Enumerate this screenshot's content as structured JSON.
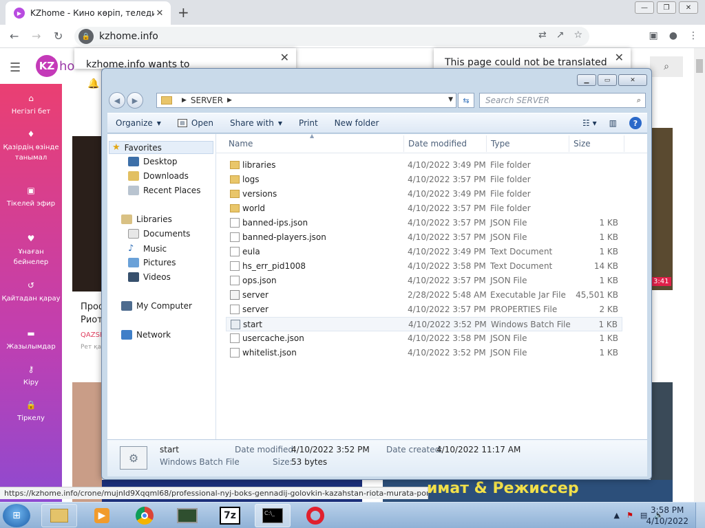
{
  "browser": {
    "tab_title": "KZhome - Кино көріп, теледидар",
    "url": "kzhome.info",
    "status_url": "https://kzhome.info/crone/mujnId9Xqqml68/professional-nyj-boks-gennadij-golovkin-kazahstan-riota-murata-poni"
  },
  "popups": {
    "permission_text": "kzhome.info wants to",
    "translate_text": "This page could not be translated"
  },
  "site": {
    "logo_letters": "KZ",
    "logo_text": "ho",
    "sidebar": [
      {
        "icon": "home-icon",
        "label": "Негізгі бет"
      },
      {
        "icon": "fire-icon",
        "label": "Қазірдің өзінде танымал"
      },
      {
        "icon": "live-icon",
        "label": "Тікелей эфир"
      },
      {
        "icon": "heart-icon",
        "label": "Ұнаған бейнелер"
      },
      {
        "icon": "history-icon",
        "label": "Қайтадан қарау"
      },
      {
        "icon": "folder-icon",
        "label": "Жазылымдар"
      },
      {
        "icon": "key-icon",
        "label": "Кіру"
      },
      {
        "icon": "lock-icon",
        "label": "Тіркелу"
      }
    ],
    "card": {
      "title_line1": "Проф",
      "title_line2": "Риота",
      "channel": "QAZSP",
      "meta": "Рет қа",
      "time_badge": "3:41"
    },
    "banner_text": "имат & Режиссер"
  },
  "explorer": {
    "breadcrumb": "SERVER",
    "search_placeholder": "Search SERVER",
    "commands": {
      "organize": "Organize",
      "open": "Open",
      "share": "Share with",
      "print": "Print",
      "new_folder": "New folder"
    },
    "nav": {
      "favorites": "Favorites",
      "desktop": "Desktop",
      "downloads": "Downloads",
      "recent": "Recent Places",
      "libraries": "Libraries",
      "documents": "Documents",
      "music": "Music",
      "pictures": "Pictures",
      "videos": "Videos",
      "computer": "My Computer",
      "network": "Network"
    },
    "columns": {
      "name": "Name",
      "date": "Date modified",
      "type": "Type",
      "size": "Size"
    },
    "files": [
      {
        "name": "libraries",
        "date": "4/10/2022 3:49 PM",
        "type": "File folder",
        "size": "",
        "kind": "folder"
      },
      {
        "name": "logs",
        "date": "4/10/2022 3:57 PM",
        "type": "File folder",
        "size": "",
        "kind": "folder"
      },
      {
        "name": "versions",
        "date": "4/10/2022 3:49 PM",
        "type": "File folder",
        "size": "",
        "kind": "folder"
      },
      {
        "name": "world",
        "date": "4/10/2022 3:57 PM",
        "type": "File folder",
        "size": "",
        "kind": "folder"
      },
      {
        "name": "banned-ips.json",
        "date": "4/10/2022 3:57 PM",
        "type": "JSON File",
        "size": "1 KB",
        "kind": "file"
      },
      {
        "name": "banned-players.json",
        "date": "4/10/2022 3:57 PM",
        "type": "JSON File",
        "size": "1 KB",
        "kind": "file"
      },
      {
        "name": "eula",
        "date": "4/10/2022 3:49 PM",
        "type": "Text Document",
        "size": "1 KB",
        "kind": "file"
      },
      {
        "name": "hs_err_pid1008",
        "date": "4/10/2022 3:58 PM",
        "type": "Text Document",
        "size": "14 KB",
        "kind": "file"
      },
      {
        "name": "ops.json",
        "date": "4/10/2022 3:57 PM",
        "type": "JSON File",
        "size": "1 KB",
        "kind": "file"
      },
      {
        "name": "server",
        "date": "2/28/2022 5:48 AM",
        "type": "Executable Jar File",
        "size": "45,501 KB",
        "kind": "jar"
      },
      {
        "name": "server",
        "date": "4/10/2022 3:57 PM",
        "type": "PROPERTIES File",
        "size": "2 KB",
        "kind": "file"
      },
      {
        "name": "start",
        "date": "4/10/2022 3:52 PM",
        "type": "Windows Batch File",
        "size": "1 KB",
        "kind": "bat"
      },
      {
        "name": "usercache.json",
        "date": "4/10/2022 3:58 PM",
        "type": "JSON File",
        "size": "1 KB",
        "kind": "file"
      },
      {
        "name": "whitelist.json",
        "date": "4/10/2022 3:52 PM",
        "type": "JSON File",
        "size": "1 KB",
        "kind": "file"
      }
    ],
    "selected_index": 11,
    "details": {
      "name": "start",
      "type": "Windows Batch File",
      "modified_label": "Date modified:",
      "modified": "4/10/2022 3:52 PM",
      "created_label": "Date created:",
      "created": "4/10/2022 11:17 AM",
      "size_label": "Size:",
      "size": "53 bytes"
    }
  },
  "taskbar": {
    "apps": [
      "explorer-app-icon",
      "media-player-icon",
      "chrome-icon",
      "terminal-app-icon",
      "7zip-icon",
      "cmd-icon",
      "opera-icon"
    ],
    "sevenzip_label": "7z",
    "clock_time": "3:58 PM",
    "clock_date": "4/10/2022"
  }
}
